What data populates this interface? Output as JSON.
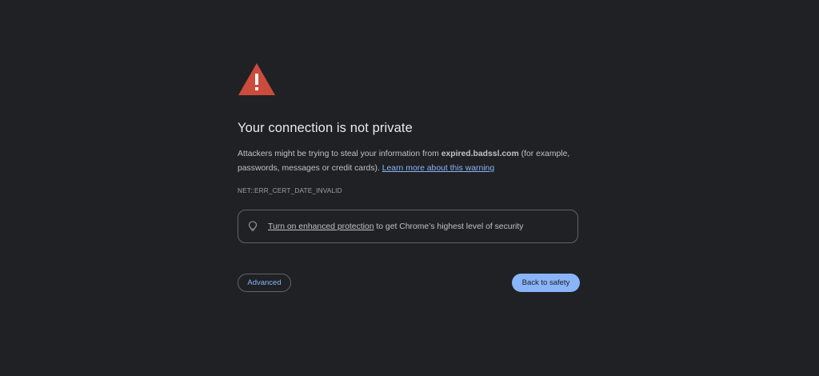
{
  "warning": {
    "icon": "warning-triangle-icon",
    "icon_color": "#cb4b3c"
  },
  "title": "Your connection is not private",
  "description": {
    "part1": "Attackers might be trying to steal your information from ",
    "domain": "expired.badssl.com",
    "part2": " (for example, passwords, messages or credit cards). ",
    "learn_more": "Learn more about this warning"
  },
  "error_code": "NET::ERR_CERT_DATE_INVALID",
  "protection": {
    "icon": "lightbulb-icon",
    "link_text": "Turn on enhanced protection",
    "rest_text": " to get Chrome’s highest level of security"
  },
  "buttons": {
    "advanced": "Advanced",
    "back_to_safety": "Back to safety"
  },
  "colors": {
    "background": "#202124",
    "accent": "#8ab4f8"
  }
}
